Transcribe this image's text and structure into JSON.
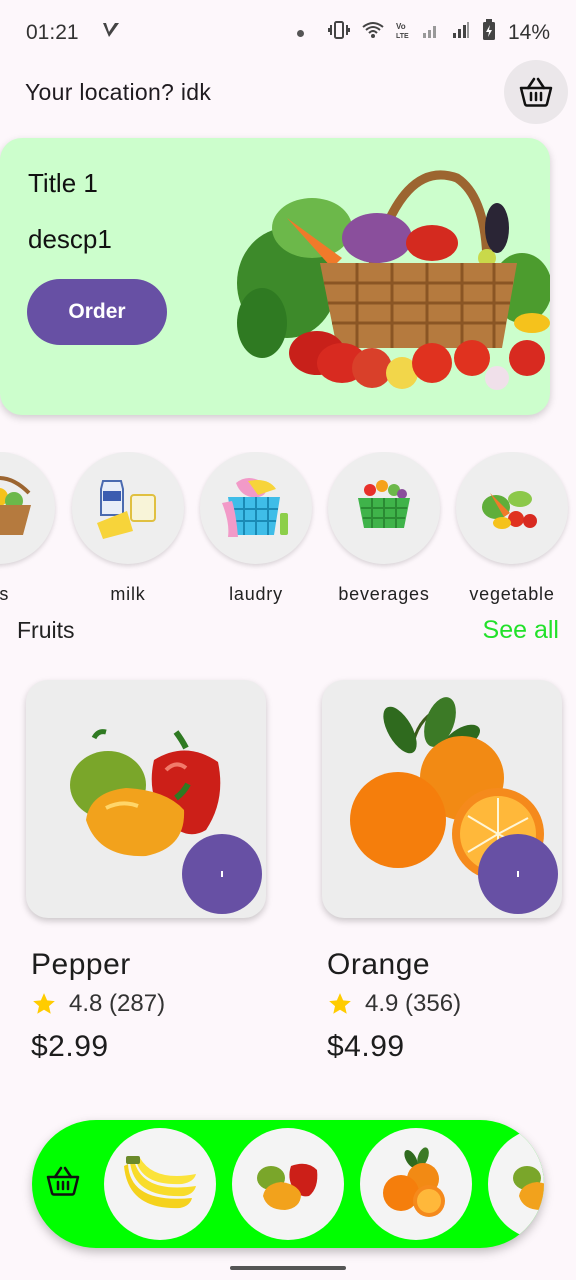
{
  "status_bar": {
    "time": "01:21",
    "battery": "14%"
  },
  "header": {
    "location_text": "Your location? idk"
  },
  "banner": {
    "title": "Title 1",
    "description": "descp1",
    "button_label": "Order"
  },
  "categories": [
    {
      "label": "its",
      "icon": "fruit-basket-icon"
    },
    {
      "label": "milk",
      "icon": "milk-icon"
    },
    {
      "label": "laudry",
      "icon": "laundry-basket-icon"
    },
    {
      "label": "beverages",
      "icon": "beverages-basket-icon"
    },
    {
      "label": "vegetable",
      "icon": "vegetable-icon"
    }
  ],
  "section": {
    "title": "Fruits",
    "see_all": "See all"
  },
  "products": [
    {
      "name": "Pepper",
      "rating": "4.8 (287)",
      "price": "$2.99",
      "image": "pepper-image"
    },
    {
      "name": "Orange",
      "rating": "4.9 (356)",
      "price": "$4.99",
      "image": "orange-image"
    }
  ],
  "bottom_bar": {
    "items": [
      "banana-image",
      "pepper-image",
      "orange-image",
      "pepper-image"
    ]
  },
  "colors": {
    "primary": "#6750a4",
    "banner_bg": "#ccfecc",
    "accent_green": "#22e12a",
    "bottom_bar_bg": "#00ff00",
    "star": "#ffcc00"
  }
}
